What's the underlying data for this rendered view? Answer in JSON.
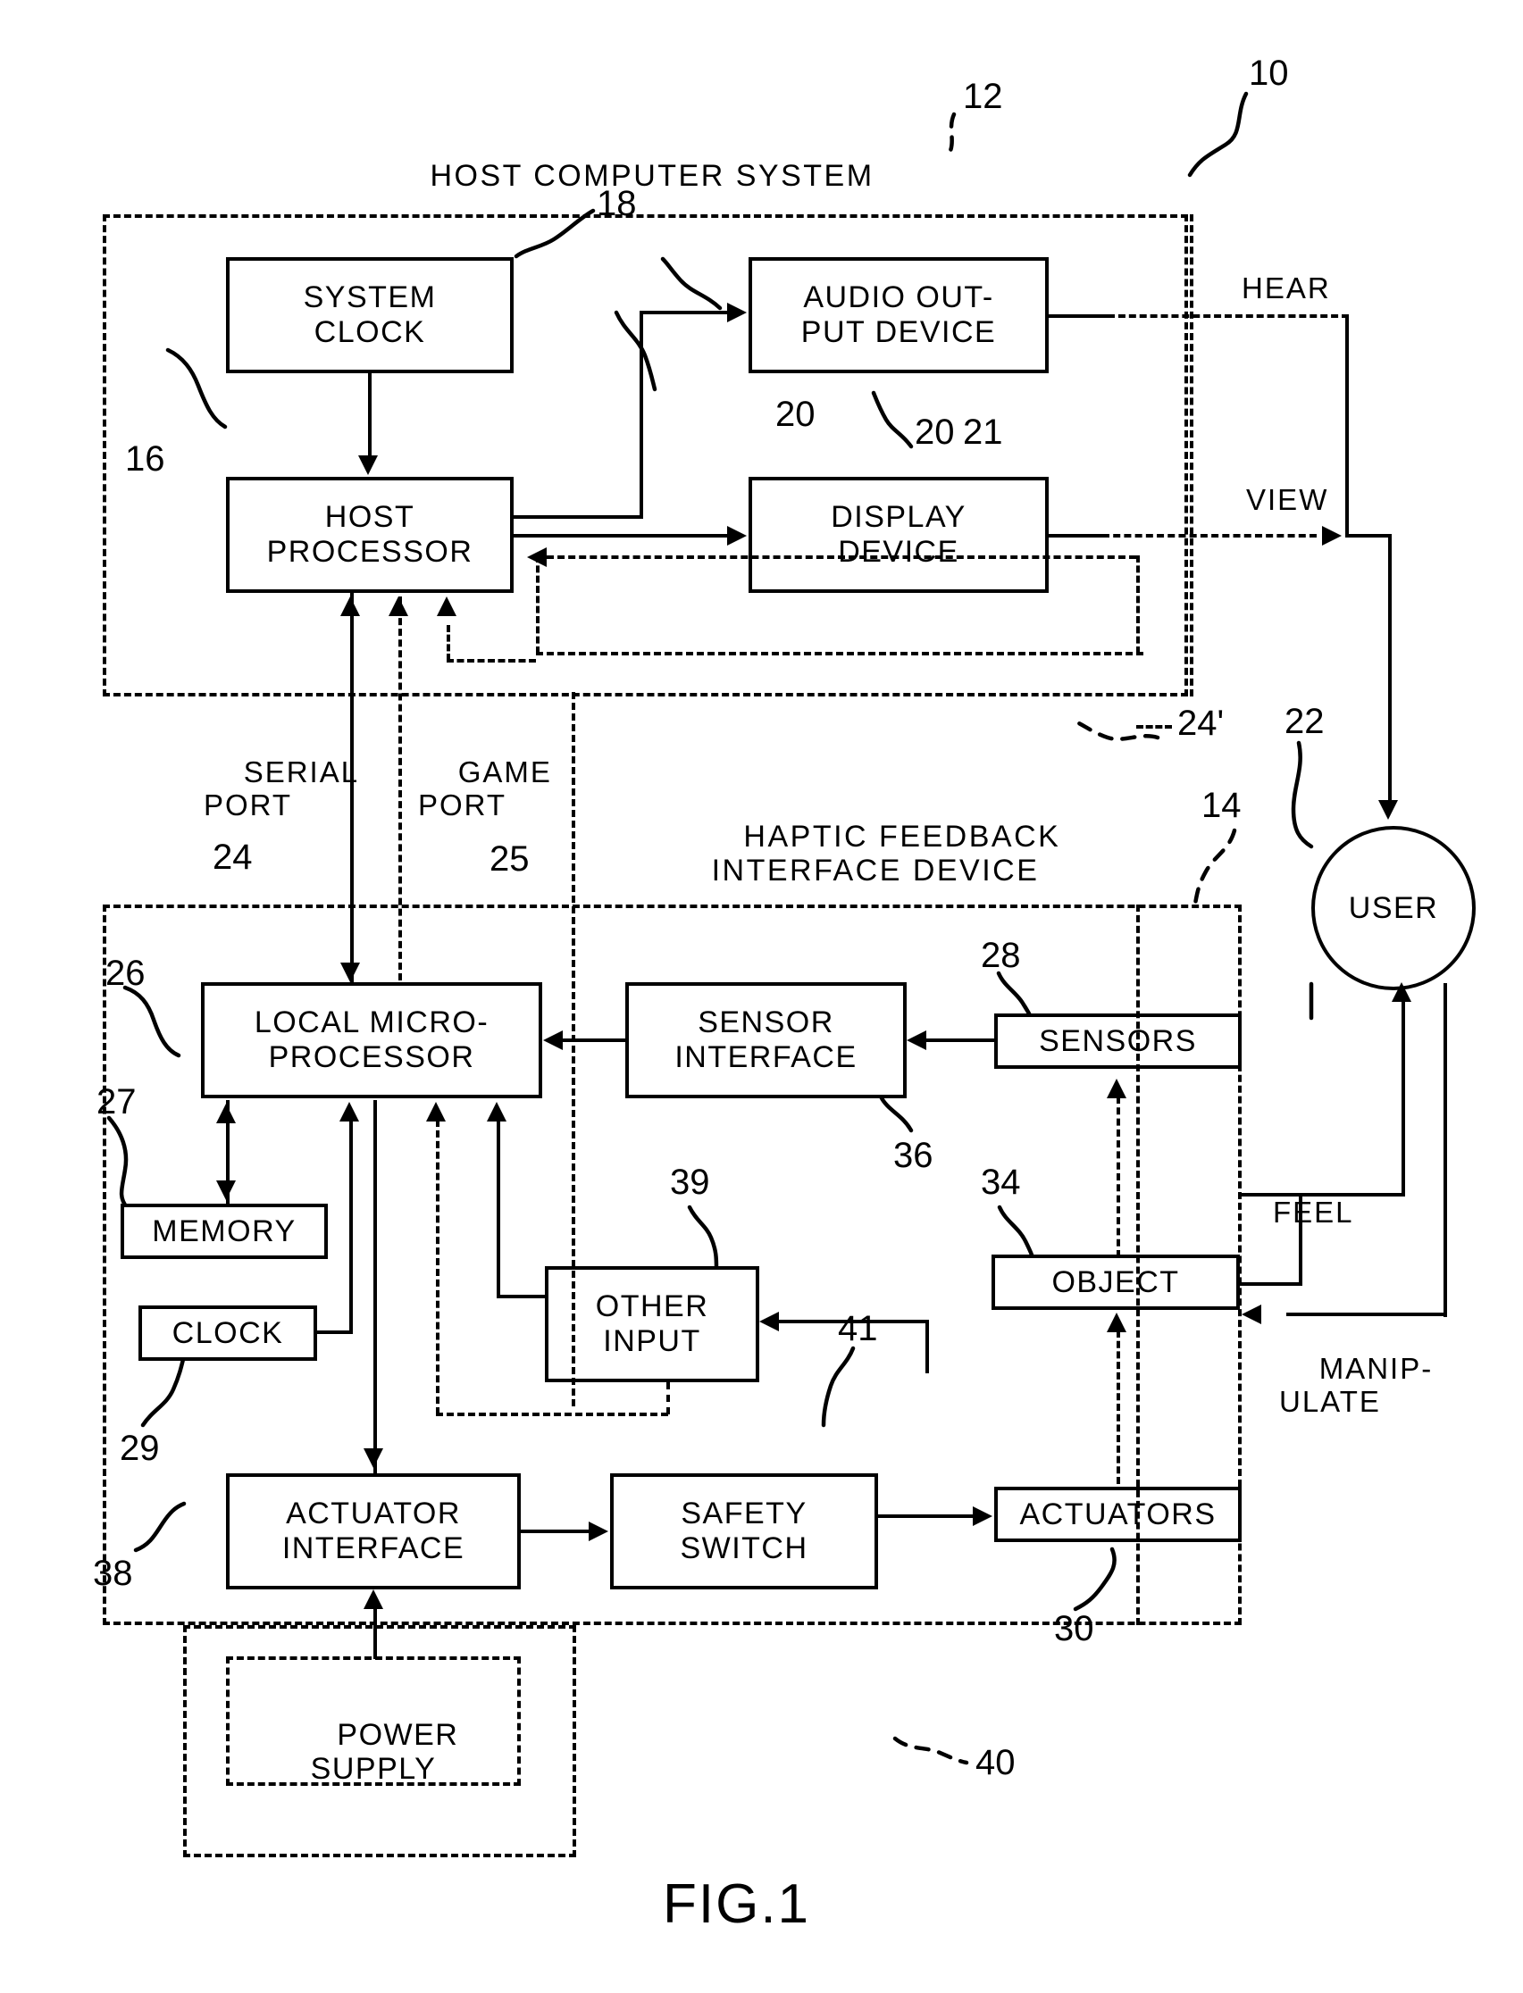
{
  "figure": {
    "caption": "FIG.1",
    "top_ref": "10"
  },
  "sections": {
    "host": {
      "title": "HOST COMPUTER SYSTEM",
      "ref": "12"
    },
    "device": {
      "title_line1": "HAPTIC FEEDBACK",
      "title_line2": "INTERFACE DEVICE",
      "ref": "14"
    }
  },
  "blocks": {
    "system_clock": {
      "line1": "SYSTEM",
      "line2": "CLOCK",
      "ref": "18"
    },
    "audio_output": {
      "line1": "AUDIO OUT-",
      "line2": "PUT DEVICE",
      "ref": "20",
      "ref2": "21"
    },
    "host_processor": {
      "line1": "HOST",
      "line2": "PROCESSOR",
      "ref": "16"
    },
    "display_device": {
      "line1": "DISPLAY",
      "line2": "DEVICE",
      "ref": "20b"
    },
    "local_microprocessor": {
      "line1": "LOCAL MICRO-",
      "line2": "PROCESSOR",
      "ref": "26"
    },
    "sensor_interface": {
      "line1": "SENSOR",
      "line2": "INTERFACE",
      "ref": "36"
    },
    "sensors": {
      "line1": "SENSORS",
      "ref": "28"
    },
    "memory": {
      "line1": "MEMORY",
      "ref": "27"
    },
    "clock": {
      "line1": "CLOCK",
      "ref": "29"
    },
    "other_input": {
      "line1": "OTHER",
      "line2": "INPUT",
      "ref": "39"
    },
    "object": {
      "line1": "OBJECT",
      "ref": "34"
    },
    "actuator_interface": {
      "line1": "ACTUATOR",
      "line2": "INTERFACE",
      "ref": "38"
    },
    "safety_switch": {
      "line1": "SAFETY",
      "line2": "SWITCH",
      "ref": "41"
    },
    "actuators": {
      "line1": "ACTUATORS",
      "ref": "30"
    },
    "power_supply": {
      "line1": "POWER",
      "line2": "SUPPLY",
      "ref": "40"
    },
    "user": {
      "line1": "USER",
      "ref": "22"
    }
  },
  "ports": {
    "serial": {
      "line1": "SERIAL",
      "line2": "PORT",
      "ref": "24"
    },
    "game": {
      "line1": "GAME",
      "line2": "PORT",
      "ref": "25"
    },
    "serial_prime_ref": "24'"
  },
  "user_channels": {
    "hear": "HEAR",
    "view": "VIEW",
    "feel": "FEEL",
    "manipulate_line1": "MANIP-",
    "manipulate_line2": "ULATE"
  },
  "colors": {
    "ink": "#000000",
    "paper": "#ffffff"
  }
}
